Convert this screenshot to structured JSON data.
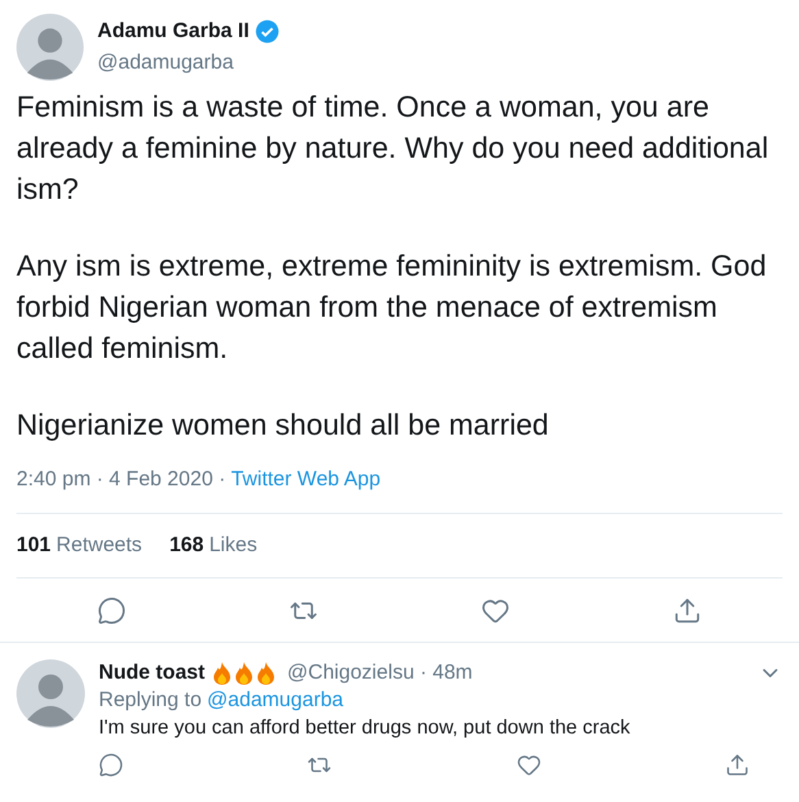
{
  "tweet": {
    "author": {
      "name": "Adamu Garba II",
      "verified": true,
      "handle": "@adamugarba"
    },
    "paragraphs": [
      "Feminism is a waste of time. Once a woman, you are already a feminine by nature. Why do you need additional ism?",
      "Any ism is extreme, extreme femininity is extremism. God forbid Nigerian woman from the menace of extremism called feminism.",
      "Nigerianize women should all be married"
    ],
    "time": "2:40 pm · 4 Feb 2020 ·",
    "source": "Twitter Web App",
    "stats": [
      {
        "count": "101",
        "label": "Retweets"
      },
      {
        "count": "168",
        "label": "Likes"
      }
    ]
  },
  "reply": {
    "name": "Nude toast",
    "handle": "@Chigozielsu · 48m",
    "replying_prefix": "Replying to",
    "replying_to": "@adamugarba",
    "text": "I'm sure you can afford better drugs now, put down the crack"
  }
}
